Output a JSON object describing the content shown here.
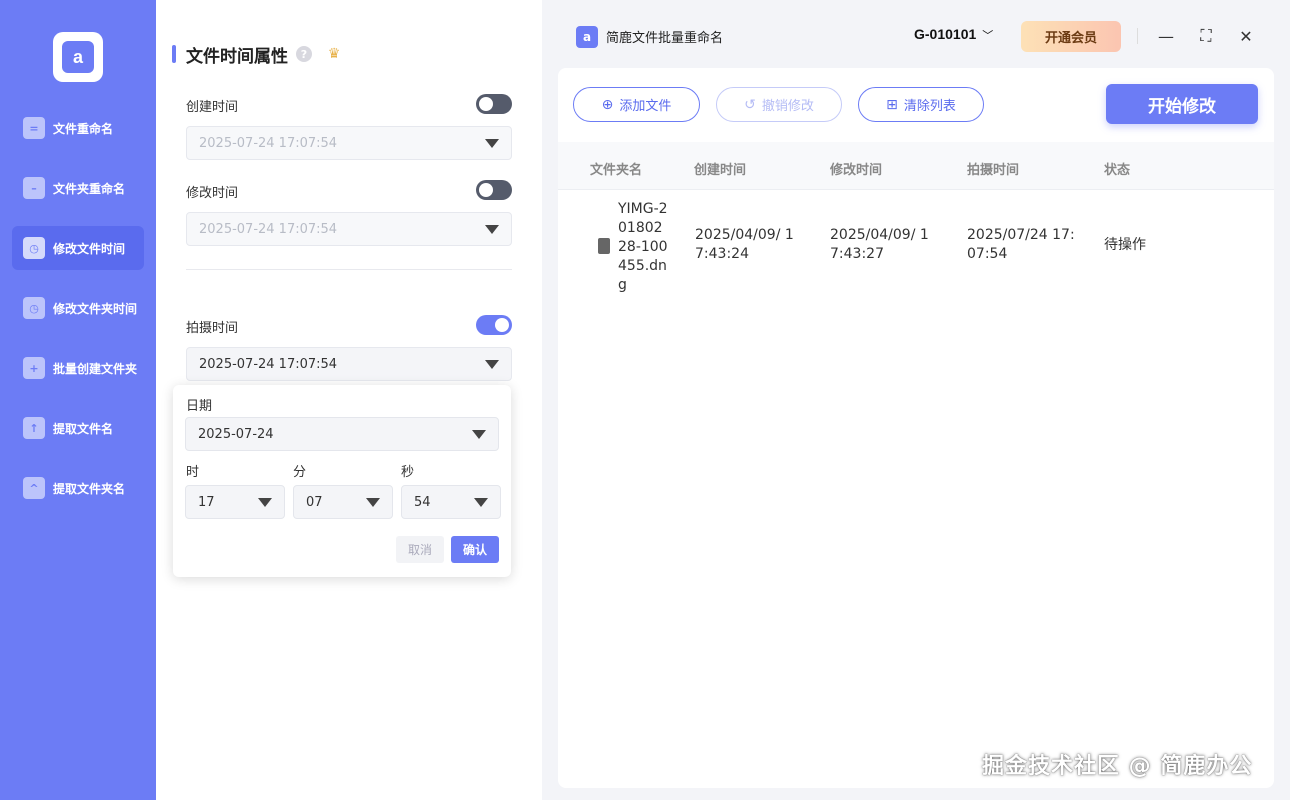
{
  "sidebar": {
    "logo_text": "a",
    "items": [
      {
        "label": "文件重命名",
        "icon": "doc-icon",
        "glyph": "="
      },
      {
        "label": "文件夹重命名",
        "icon": "folder-icon",
        "glyph": "–"
      },
      {
        "label": "修改文件时间",
        "icon": "clock-doc-icon",
        "glyph": "◷"
      },
      {
        "label": "修改文件夹时间",
        "icon": "clock-folder-icon",
        "glyph": "◷"
      },
      {
        "label": "批量创建文件夹",
        "icon": "folder-add-icon",
        "glyph": "+"
      },
      {
        "label": "提取文件名",
        "icon": "upload-doc-icon",
        "glyph": "↑"
      },
      {
        "label": "提取文件夹名",
        "icon": "upload-folder-icon",
        "glyph": "^"
      }
    ],
    "active_index": 2
  },
  "settings": {
    "title": "文件时间属性",
    "created": {
      "label": "创建时间",
      "enabled": false,
      "value": "2025-07-24 17:07:54"
    },
    "modified": {
      "label": "修改时间",
      "enabled": false,
      "value": "2025-07-24 17:07:54"
    },
    "captured": {
      "label": "拍摄时间",
      "enabled": true,
      "value": "2025-07-24 17:07:54"
    }
  },
  "picker": {
    "date_label": "日期",
    "date_value": "2025-07-24",
    "hour_label": "时",
    "hour_value": "17",
    "minute_label": "分",
    "minute_value": "07",
    "second_label": "秒",
    "second_value": "54",
    "cancel": "取消",
    "confirm": "确认"
  },
  "titlebar": {
    "app_logo": "a",
    "app_title": "简鹿文件批量重命名",
    "account": "G-010101",
    "vip": "开通会员"
  },
  "toolbar": {
    "add": "添加文件",
    "undo": "撤销修改",
    "clear": "清除列表",
    "start": "开始修改"
  },
  "table": {
    "headers": [
      "文件夹名",
      "创建时间",
      "修改时间",
      "拍摄时间",
      "状态"
    ],
    "rows": [
      {
        "name": "YIMG-20180228-100455.dng",
        "created": "2025/04/09/ 17:43:24",
        "modified": "2025/04/09/ 17:43:27",
        "captured": "2025/07/24 17:07:54",
        "status": "待操作"
      }
    ]
  },
  "watermark": "掘金技术社区 @ 简鹿办公",
  "colors": {
    "accent": "#6c7cf5",
    "sidebar": "#6c7cf5",
    "vip_gradient_start": "#fde1b6",
    "vip_gradient_end": "#fbc5b1"
  }
}
